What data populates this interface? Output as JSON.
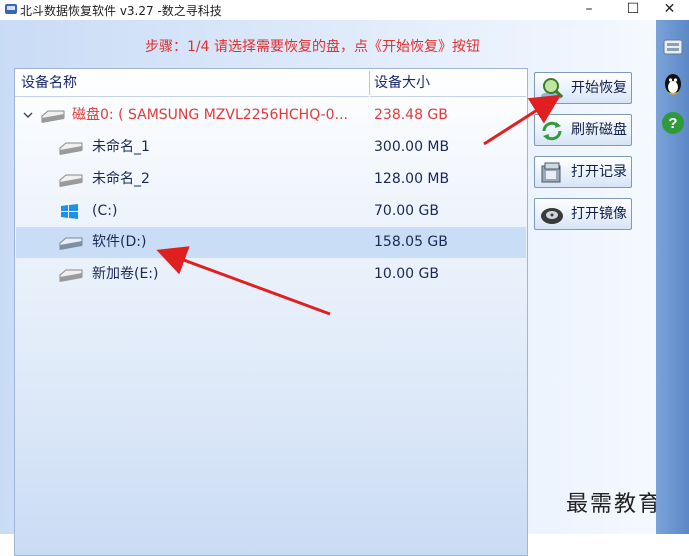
{
  "window": {
    "title": "北斗数据恢复软件 v3.27 -数之寻科技",
    "minimize": "–",
    "maximize": "☐",
    "close": "✕"
  },
  "step_text": "步骤：1/4 请选择需要恢复的盘，点《开始恢复》按钮",
  "table": {
    "col_name": "设备名称",
    "col_size": "设备大小",
    "rows": [
      {
        "name": "磁盘0: ( SAMSUNG MZVL2256HCHQ-0...",
        "size": "238.48 GB",
        "icon": "hard-disk-icon"
      },
      {
        "name": "未命名_1",
        "size": "300.00 MB",
        "icon": "drive-icon"
      },
      {
        "name": "未命名_2",
        "size": "128.00 MB",
        "icon": "drive-icon"
      },
      {
        "name": "(C:)",
        "size": "70.00 GB",
        "icon": "windows-icon"
      },
      {
        "name": "软件(D:)",
        "size": "158.05 GB",
        "icon": "drive-icon"
      },
      {
        "name": "新加卷(E:)",
        "size": "10.00 GB",
        "icon": "drive-icon"
      }
    ],
    "selected_index": 4
  },
  "buttons": {
    "start": "开始恢复",
    "refresh": "刷新磁盘",
    "open_record": "打开记录",
    "open_image": "打开镜像"
  },
  "right_bar_icons": [
    "tools-icon",
    "qq-penguin-icon",
    "help-icon"
  ],
  "watermark": "最需教育",
  "colors": {
    "step_red": "#e03030",
    "disk_red": "#e23a3a",
    "selection": "#c9ddf7",
    "arrow_red": "#e02020"
  }
}
